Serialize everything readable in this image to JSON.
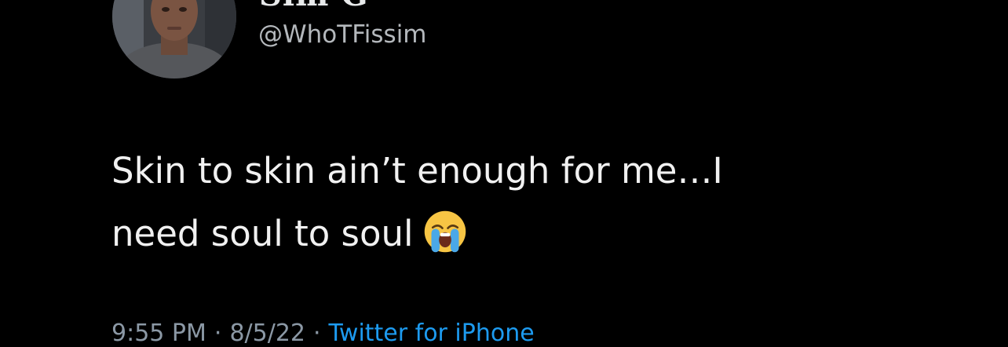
{
  "tweet": {
    "display_name": "Sim G",
    "handle": "@WhoTFissim",
    "text_line_1": "Skin to skin ain’t enough for me…I",
    "text_line_2": "need soul to soul",
    "emoji": "loudly-crying-face-icon",
    "time": "9:55 PM",
    "separator_1": "·",
    "date": "8/5/22",
    "separator_2": "·",
    "source": "Twitter for iPhone"
  },
  "colors": {
    "background": "#000000",
    "text": "#e7e9ea",
    "secondary": "#8b98a5",
    "link": "#1d9bf0"
  }
}
